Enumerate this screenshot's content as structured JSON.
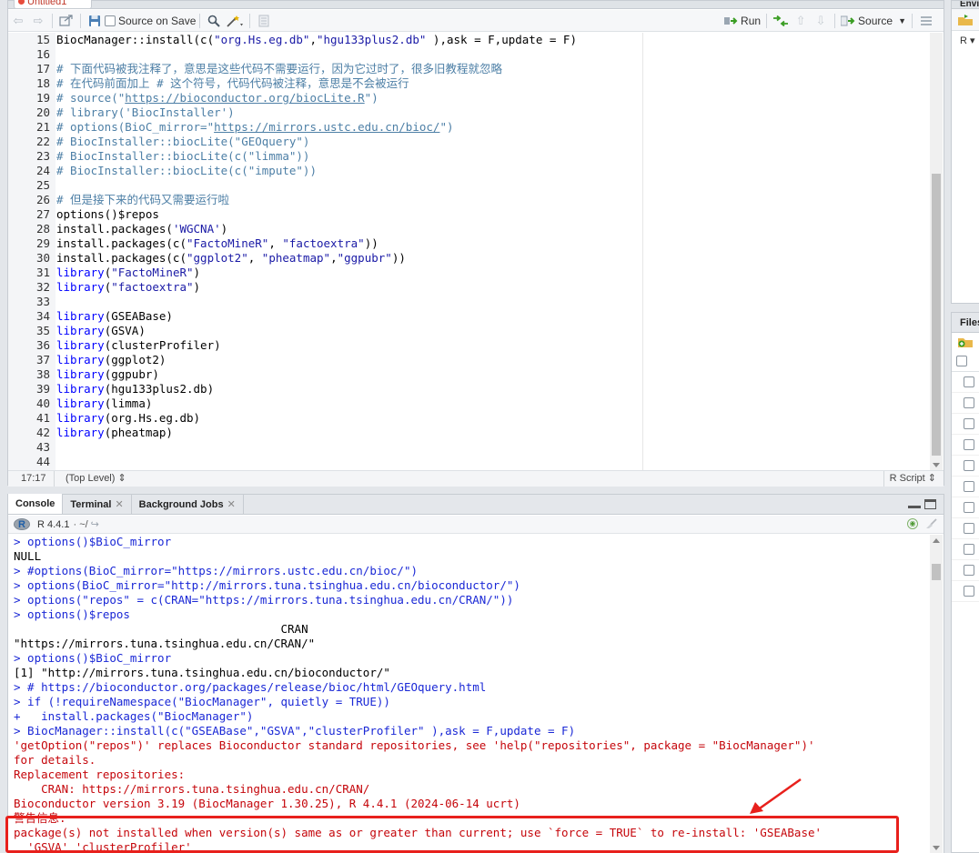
{
  "editor": {
    "tab_title": "Untitled1",
    "toolbar": {
      "source_on_save_label": "Source on Save",
      "run_label": "Run",
      "source_label": "Source"
    },
    "lines": [
      {
        "n": "15",
        "segs": [
          {
            "t": "BiocManager::install(c(",
            "c": ""
          },
          {
            "t": "\"org.Hs.eg.db\"",
            "c": "str"
          },
          {
            "t": ",",
            "c": ""
          },
          {
            "t": "\"hgu133plus2.db\"",
            "c": "str"
          },
          {
            "t": " ),ask = F,update = F)",
            "c": ""
          }
        ]
      },
      {
        "n": "16",
        "segs": []
      },
      {
        "n": "17",
        "segs": [
          {
            "t": "# 下面代码被我注释了，意思是这些代码不需要运行，因为它过时了，很多旧教程就忽略",
            "c": "cm"
          }
        ]
      },
      {
        "n": "18",
        "segs": [
          {
            "t": "# 在代码前面加上 # 这个符号，代码代码被注释，意思是不会被运行",
            "c": "cm"
          }
        ]
      },
      {
        "n": "19",
        "segs": [
          {
            "t": "# source(\"",
            "c": "cm"
          },
          {
            "t": "https://bioconductor.org/biocLite.R",
            "c": "cm url"
          },
          {
            "t": "\")",
            "c": "cm"
          }
        ]
      },
      {
        "n": "20",
        "segs": [
          {
            "t": "# library('BiocInstaller')",
            "c": "cm"
          }
        ]
      },
      {
        "n": "21",
        "segs": [
          {
            "t": "# options(BioC_mirror=\"",
            "c": "cm"
          },
          {
            "t": "https://mirrors.ustc.edu.cn/bioc/",
            "c": "cm url"
          },
          {
            "t": "\")",
            "c": "cm"
          }
        ]
      },
      {
        "n": "22",
        "segs": [
          {
            "t": "# BiocInstaller::biocLite(\"GEOquery\")",
            "c": "cm"
          }
        ]
      },
      {
        "n": "23",
        "segs": [
          {
            "t": "# BiocInstaller::biocLite(c(\"limma\"))",
            "c": "cm"
          }
        ]
      },
      {
        "n": "24",
        "segs": [
          {
            "t": "# BiocInstaller::biocLite(c(\"impute\"))",
            "c": "cm"
          }
        ]
      },
      {
        "n": "25",
        "segs": []
      },
      {
        "n": "26",
        "segs": [
          {
            "t": "# 但是接下来的代码又需要运行啦",
            "c": "cm"
          }
        ]
      },
      {
        "n": "27",
        "segs": [
          {
            "t": "options()$repos",
            "c": ""
          }
        ]
      },
      {
        "n": "28",
        "segs": [
          {
            "t": "install.packages(",
            "c": ""
          },
          {
            "t": "'WGCNA'",
            "c": "str"
          },
          {
            "t": ")",
            "c": ""
          }
        ]
      },
      {
        "n": "29",
        "segs": [
          {
            "t": "install.packages(c(",
            "c": ""
          },
          {
            "t": "\"FactoMineR\"",
            "c": "str"
          },
          {
            "t": ", ",
            "c": ""
          },
          {
            "t": "\"factoextra\"",
            "c": "str"
          },
          {
            "t": "))",
            "c": ""
          }
        ]
      },
      {
        "n": "30",
        "segs": [
          {
            "t": "install.packages(c(",
            "c": ""
          },
          {
            "t": "\"ggplot2\"",
            "c": "str"
          },
          {
            "t": ", ",
            "c": ""
          },
          {
            "t": "\"pheatmap\"",
            "c": "str"
          },
          {
            "t": ",",
            "c": ""
          },
          {
            "t": "\"ggpubr\"",
            "c": "str"
          },
          {
            "t": "))",
            "c": ""
          }
        ]
      },
      {
        "n": "31",
        "segs": [
          {
            "t": "library",
            "c": "kw"
          },
          {
            "t": "(",
            "c": ""
          },
          {
            "t": "\"FactoMineR\"",
            "c": "str"
          },
          {
            "t": ")",
            "c": ""
          }
        ]
      },
      {
        "n": "32",
        "segs": [
          {
            "t": "library",
            "c": "kw"
          },
          {
            "t": "(",
            "c": ""
          },
          {
            "t": "\"factoextra\"",
            "c": "str"
          },
          {
            "t": ")",
            "c": ""
          }
        ]
      },
      {
        "n": "33",
        "segs": []
      },
      {
        "n": "34",
        "segs": [
          {
            "t": "library",
            "c": "kw"
          },
          {
            "t": "(GSEABase)",
            "c": ""
          }
        ]
      },
      {
        "n": "35",
        "segs": [
          {
            "t": "library",
            "c": "kw"
          },
          {
            "t": "(GSVA)",
            "c": ""
          }
        ]
      },
      {
        "n": "36",
        "segs": [
          {
            "t": "library",
            "c": "kw"
          },
          {
            "t": "(clusterProfiler)",
            "c": ""
          }
        ]
      },
      {
        "n": "37",
        "segs": [
          {
            "t": "library",
            "c": "kw"
          },
          {
            "t": "(ggplot2)",
            "c": ""
          }
        ]
      },
      {
        "n": "38",
        "segs": [
          {
            "t": "library",
            "c": "kw"
          },
          {
            "t": "(ggpubr)",
            "c": ""
          }
        ]
      },
      {
        "n": "39",
        "segs": [
          {
            "t": "library",
            "c": "kw"
          },
          {
            "t": "(hgu133plus2.db)",
            "c": ""
          }
        ]
      },
      {
        "n": "40",
        "segs": [
          {
            "t": "library",
            "c": "kw"
          },
          {
            "t": "(limma)",
            "c": ""
          }
        ]
      },
      {
        "n": "41",
        "segs": [
          {
            "t": "library",
            "c": "kw"
          },
          {
            "t": "(org.Hs.eg.db)",
            "c": ""
          }
        ]
      },
      {
        "n": "42",
        "segs": [
          {
            "t": "library",
            "c": "kw"
          },
          {
            "t": "(pheatmap)",
            "c": ""
          }
        ]
      },
      {
        "n": "43",
        "segs": []
      },
      {
        "n": "44",
        "segs": []
      }
    ],
    "status": {
      "position": "17:17",
      "scope": "(Top Level) ⇕",
      "file_type": "R Script ⇕"
    }
  },
  "console": {
    "tabs": [
      {
        "label": "Console",
        "closable": false,
        "active": true
      },
      {
        "label": "Terminal",
        "closable": true,
        "active": false
      },
      {
        "label": "Background Jobs",
        "closable": true,
        "active": false
      }
    ],
    "r_version": "R 4.4.1",
    "working_dir": "· ~/",
    "lines": [
      {
        "k": "cmd",
        "t": "> options()$BioC_mirror"
      },
      {
        "k": "out",
        "t": "NULL"
      },
      {
        "k": "cmd",
        "t": "> #options(BioC_mirror=\"https://mirrors.ustc.edu.cn/bioc/\")"
      },
      {
        "k": "cmd",
        "t": "> options(BioC_mirror=\"http://mirrors.tuna.tsinghua.edu.cn/bioconductor/\")"
      },
      {
        "k": "cmd",
        "t": "> options(\"repos\" = c(CRAN=\"https://mirrors.tuna.tsinghua.edu.cn/CRAN/\"))"
      },
      {
        "k": "cmd",
        "t": "> options()$repos"
      },
      {
        "k": "out",
        "t": "                                       CRAN "
      },
      {
        "k": "out",
        "t": "\"https://mirrors.tuna.tsinghua.edu.cn/CRAN/\" "
      },
      {
        "k": "cmd",
        "t": "> options()$BioC_mirror"
      },
      {
        "k": "out",
        "t": "[1] \"http://mirrors.tuna.tsinghua.edu.cn/bioconductor/\""
      },
      {
        "k": "cmd",
        "t": "> # https://bioconductor.org/packages/release/bioc/html/GEOquery.html"
      },
      {
        "k": "cmd",
        "t": "> if (!requireNamespace(\"BiocManager\", quietly = TRUE))"
      },
      {
        "k": "cmd",
        "t": "+   install.packages(\"BiocManager\")"
      },
      {
        "k": "cmd",
        "t": "> BiocManager::install(c(\"GSEABase\",\"GSVA\",\"clusterProfiler\" ),ask = F,update = F)"
      },
      {
        "k": "err",
        "t": "'getOption(\"repos\")' replaces Bioconductor standard repositories, see 'help(\"repositories\", package = \"BiocManager\")'"
      },
      {
        "k": "err",
        "t": "for details."
      },
      {
        "k": "err",
        "t": "Replacement repositories:"
      },
      {
        "k": "err",
        "t": "    CRAN: https://mirrors.tuna.tsinghua.edu.cn/CRAN/"
      },
      {
        "k": "err",
        "t": "Bioconductor version 3.19 (BiocManager 1.30.25), R 4.4.1 (2024-06-14 ucrt)"
      },
      {
        "k": "err",
        "t": "警告信息:"
      },
      {
        "k": "err",
        "t": "package(s) not installed when version(s) same as or greater than current; use `force = TRUE` to re-install: 'GSEABase'"
      },
      {
        "k": "err",
        "t": "  'GSVA' 'clusterProfiler'"
      }
    ]
  },
  "right_panel": {
    "top_tab": "Envi",
    "r_selector": "R ▾",
    "bottom_tab": "Files"
  },
  "colors": {
    "command": "#1a28d6",
    "error": "#c5060b",
    "annotation": "#e8201c"
  }
}
